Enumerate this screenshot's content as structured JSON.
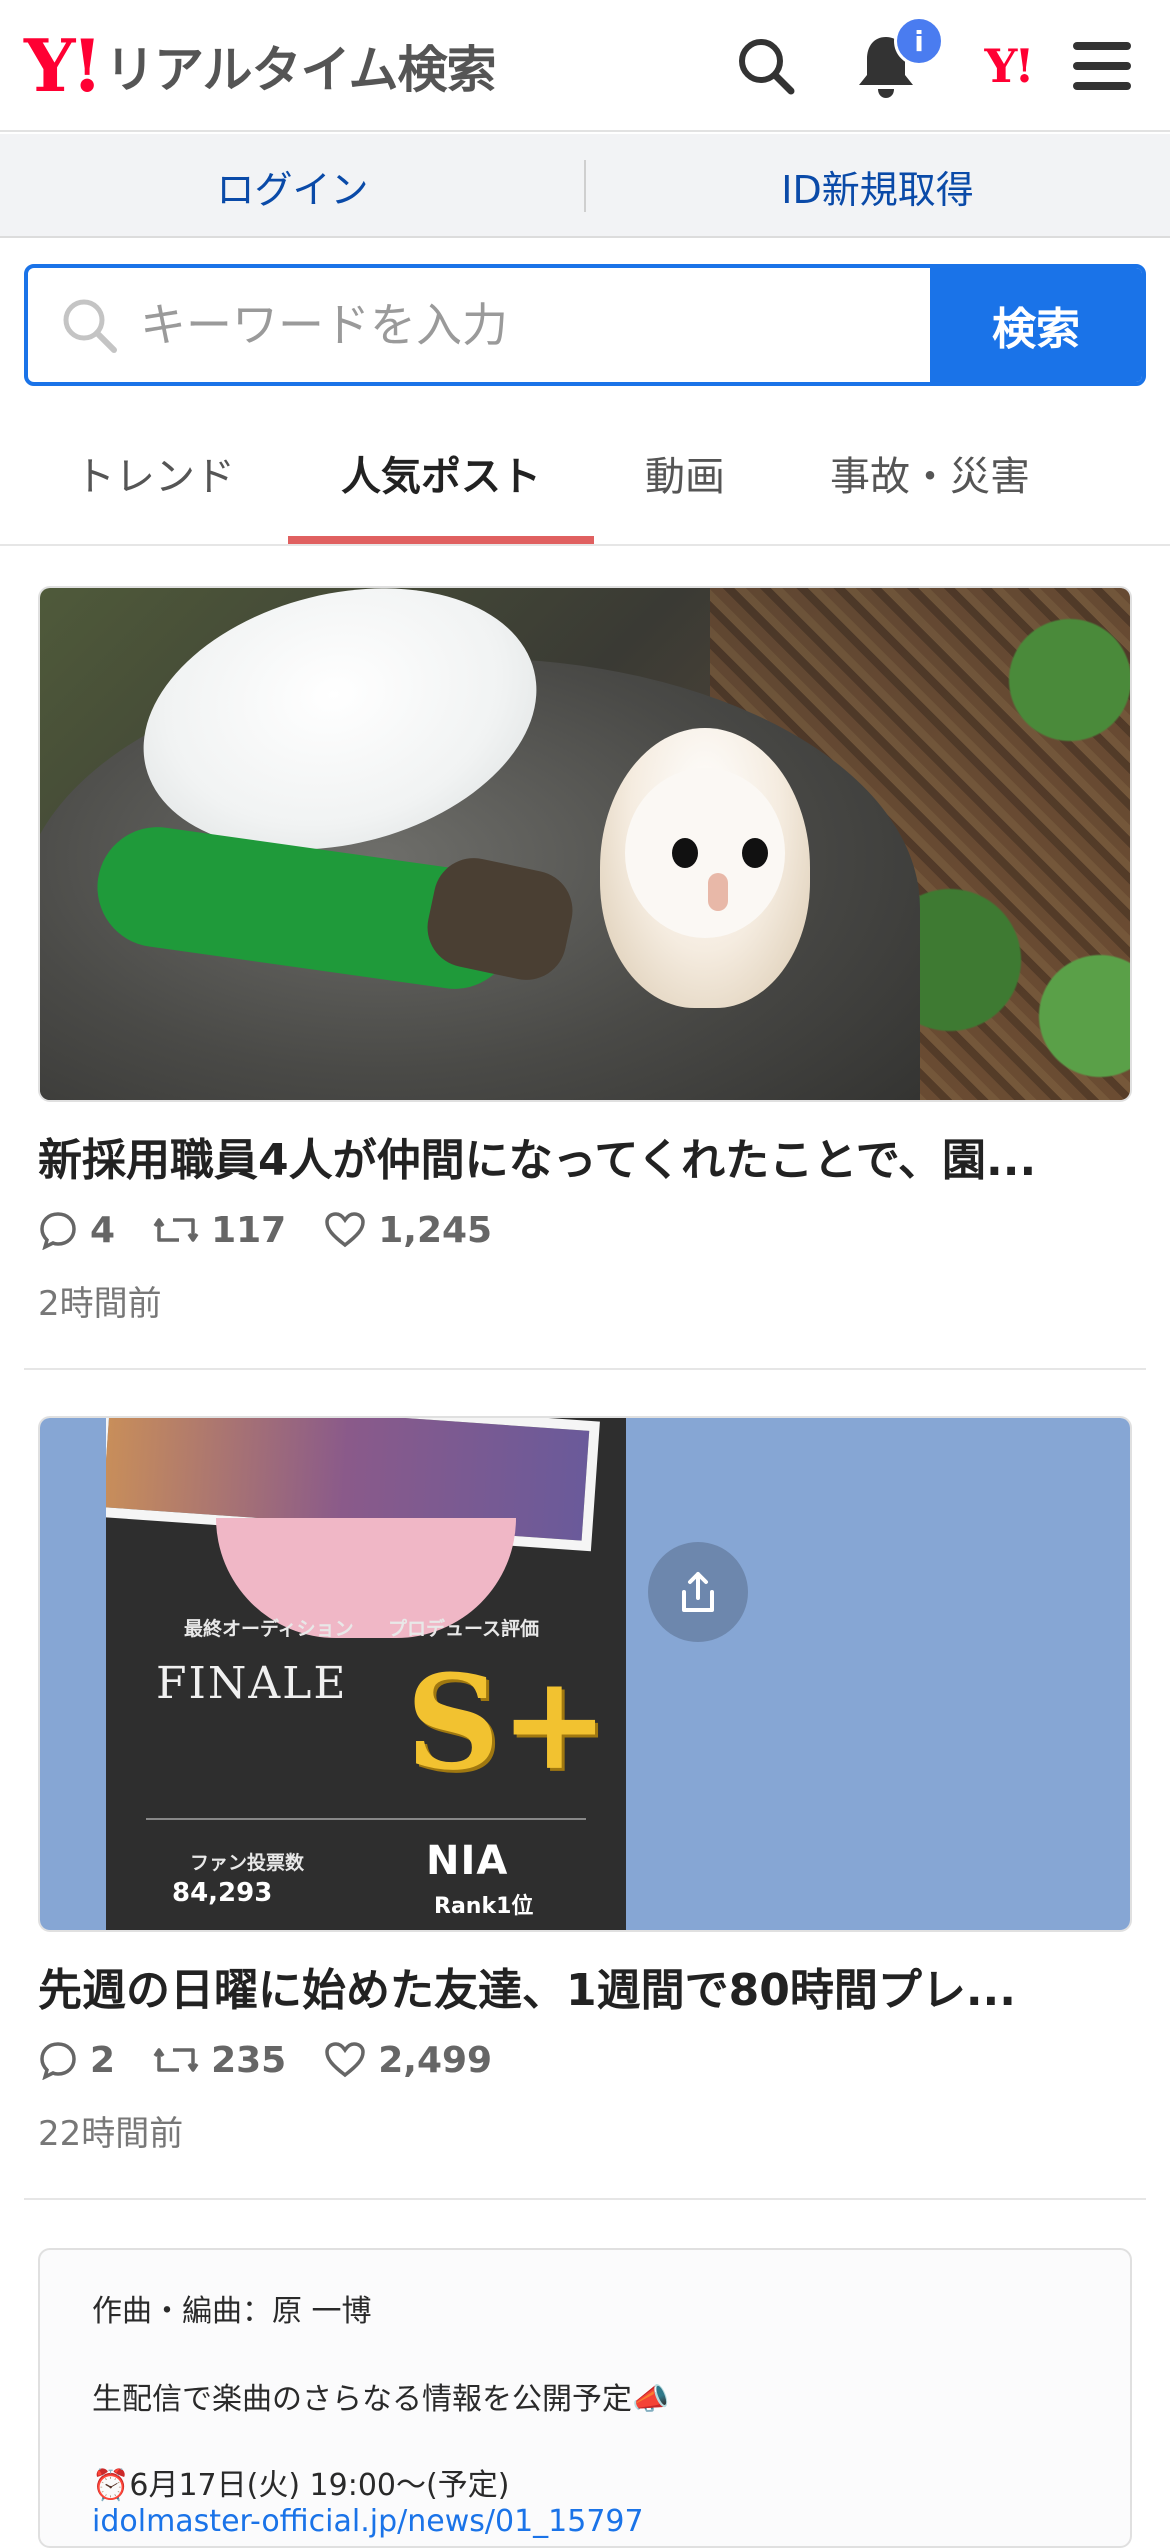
{
  "header": {
    "logo_mark": "Y!",
    "logo_text": "リアルタイム検索",
    "notification_badge": "i",
    "yahoo_mark": "Y!"
  },
  "auth": {
    "login_label": "ログイン",
    "register_label": "ID新規取得"
  },
  "search": {
    "placeholder": "キーワードを入力",
    "button_label": "検索"
  },
  "tabs": [
    {
      "label": "トレンド"
    },
    {
      "label": "人気ポスト",
      "active": true
    },
    {
      "label": "動画"
    },
    {
      "label": "事故・災害"
    }
  ],
  "posts": [
    {
      "title": "新採用職員4人が仲間になってくれたことで、園...",
      "replies": "4",
      "reposts": "117",
      "likes": "1,245",
      "time": "2時間前"
    },
    {
      "title": "先週の日曜に始めた友達、1週間で80時間プレ...",
      "replies": "2",
      "reposts": "235",
      "likes": "2,499",
      "time": "22時間前",
      "image_text": {
        "final_audition": "最終オーディション",
        "produce_eval": "プロデュース評価",
        "finale": "FINALE",
        "grade": "S+",
        "fan_votes_label": "ファン投票数",
        "fan_votes": "84,293",
        "nia": "NIA",
        "rank": "Rank1位"
      }
    },
    {
      "lines": [
        "作曲・編曲：原 一博",
        "生配信で楽曲のさらなる情報を公開予定📣",
        "⏰6月17日(火) 19:00〜(予定)",
        "idolmaster-official.jp/news/01_15797"
      ]
    }
  ],
  "colors": {
    "brand_red": "#ff0033",
    "accent_blue": "#1a73e8",
    "tab_underline": "#e06060",
    "link_blue": "#0a4aa8"
  }
}
